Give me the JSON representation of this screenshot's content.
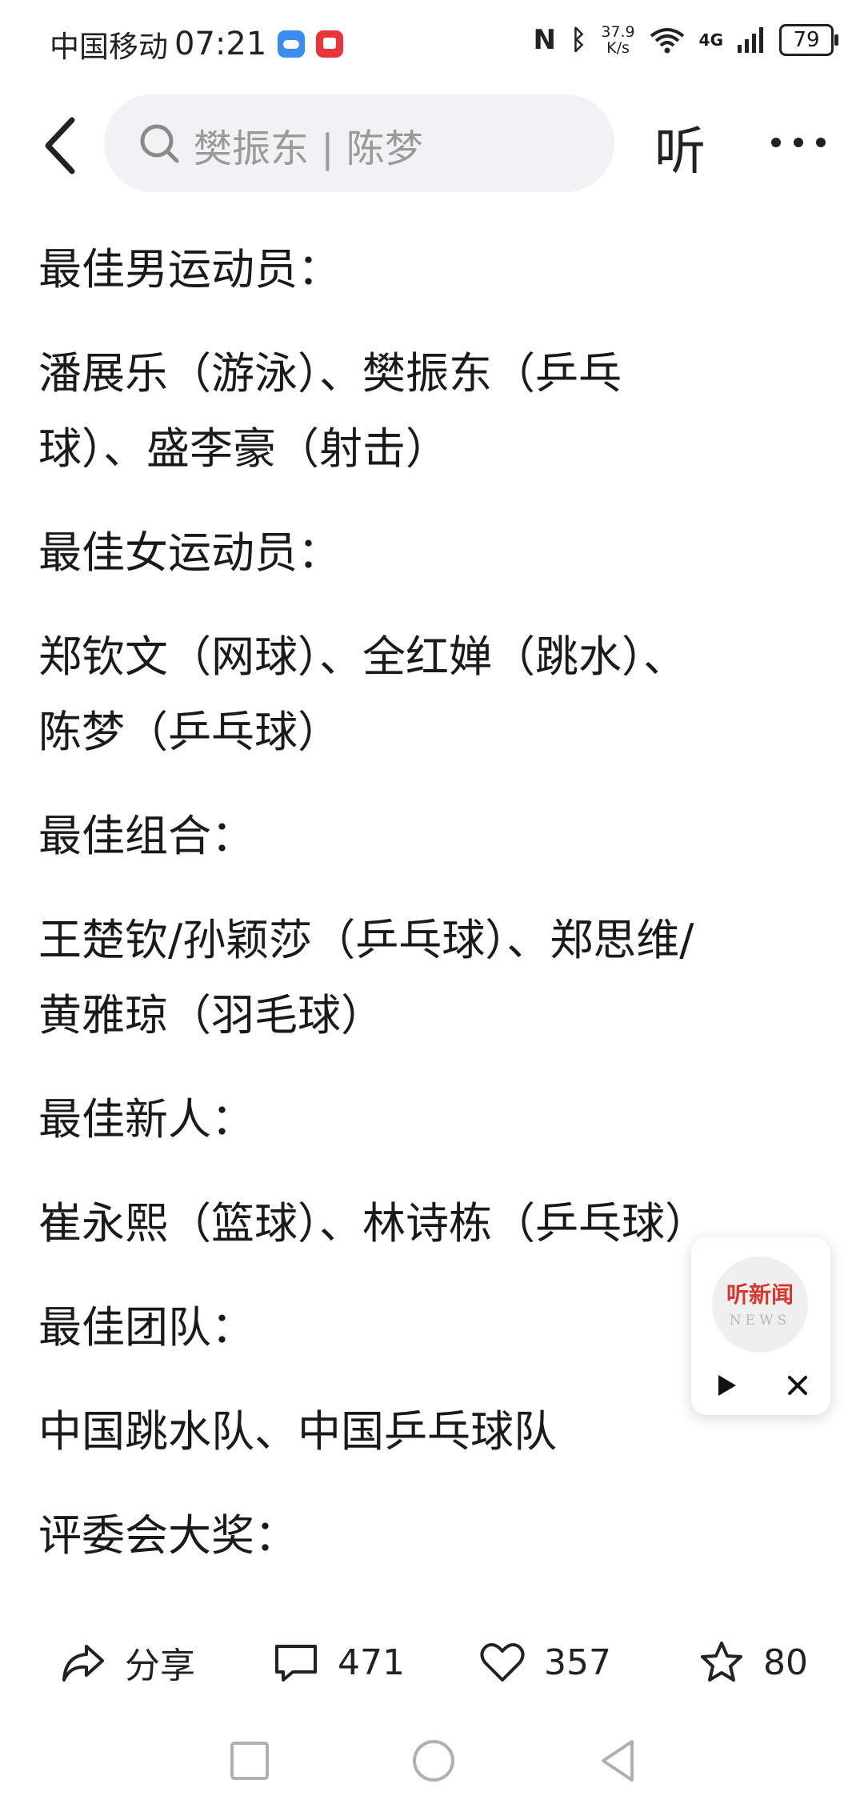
{
  "status_bar": {
    "carrier": "中国移动",
    "time": "07:21",
    "speed_top": "37.9",
    "speed_bottom": "K/s",
    "network": "4G",
    "battery": "79"
  },
  "top_nav": {
    "search_placeholder": "樊振东 | 陈梦",
    "listen_label": "听"
  },
  "article": {
    "paragraphs": [
      [
        "最佳男运动员："
      ],
      [
        "潘展乐（游泳）、樊振东（乒乓",
        "球）、盛李豪（射击）"
      ],
      [
        "最佳女运动员："
      ],
      [
        "郑钦文（网球）、全红婵（跳水）、",
        "陈梦（乒乓球）"
      ],
      [
        "最佳组合："
      ],
      [
        "王楚钦/孙颖莎（乒乓球）、郑思维/",
        "黄雅琼（羽毛球）"
      ],
      [
        "最佳新人："
      ],
      [
        "崔永熙（篮球）、林诗栋（乒乓球）"
      ],
      [
        "最佳团队："
      ],
      [
        "中国跳水队、中国乒乓球队"
      ],
      [
        "评委会大奖："
      ]
    ]
  },
  "news_player": {
    "logo_text": "听新闻",
    "logo_sub": "NEWS"
  },
  "actions": {
    "share_label": "分享",
    "comments": "471",
    "likes": "357",
    "favorites": "80"
  }
}
